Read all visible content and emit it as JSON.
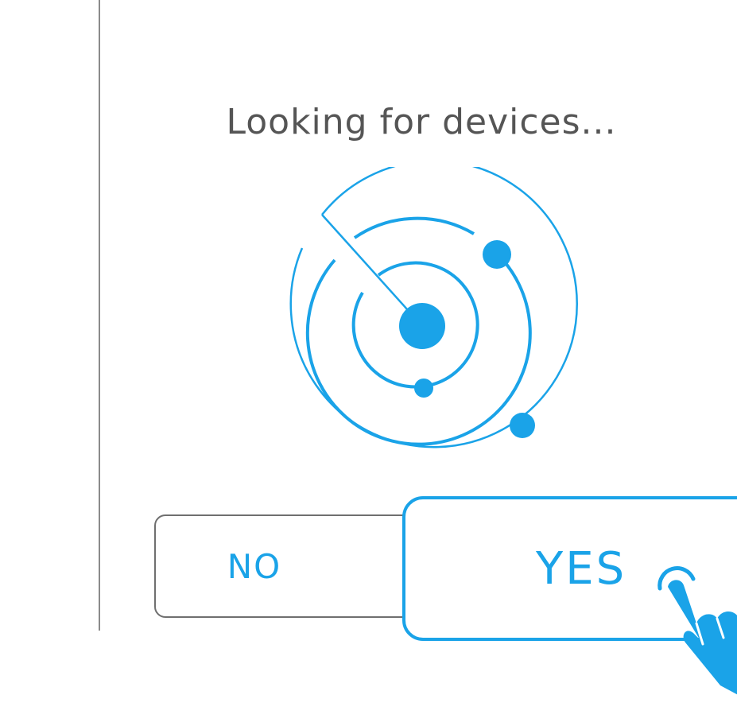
{
  "dialog": {
    "title": "Looking for devices..."
  },
  "buttons": {
    "no_label": "NO",
    "yes_label": "YES"
  },
  "icons": {
    "scanner": "radar-scan-icon",
    "pointer": "tap-hand-icon"
  },
  "colors": {
    "accent": "#1aa3e8",
    "text": "#555555",
    "border": "#8a8a8a"
  }
}
